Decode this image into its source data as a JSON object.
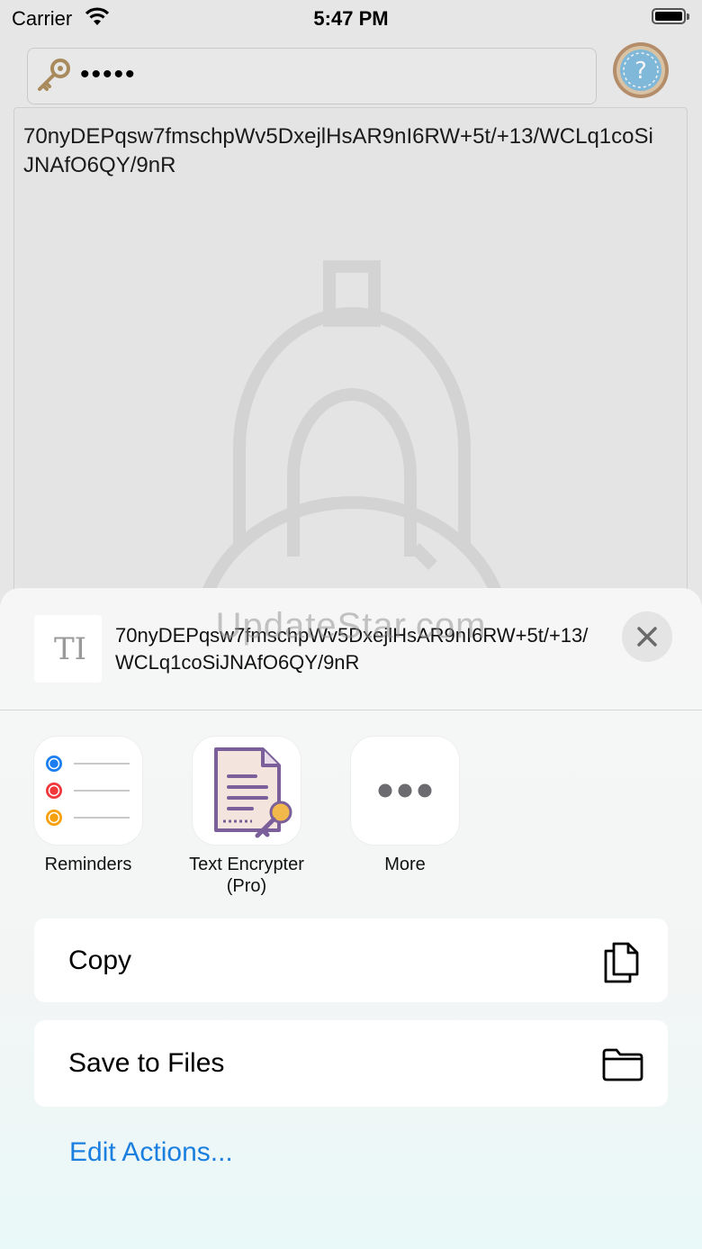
{
  "status_bar": {
    "carrier": "Carrier",
    "time": "5:47 PM"
  },
  "password_field": {
    "value": "•••••"
  },
  "editor": {
    "text": "70nyDEPqsw7fmschpWv5DxejlHsAR9nI6RW+5t/+13/WCLq1coSiJNAfO6QY/9nR"
  },
  "share_sheet": {
    "watermark": "UpdateStar.com",
    "preview_text": "70nyDEPqsw7fmschpWv5DxejlHsAR9nI6RW+5t/+13/WCLq1coSiJNAfO6QY/9nR",
    "apps": [
      {
        "label": "Reminders",
        "icon": "reminders-icon"
      },
      {
        "label": "Text Encrypter (Pro)",
        "icon": "text-encrypter-icon"
      },
      {
        "label": "More",
        "icon": "more-icon"
      }
    ],
    "actions": [
      {
        "label": "Copy",
        "icon": "copy-icon"
      },
      {
        "label": "Save to Files",
        "icon": "folder-icon"
      }
    ],
    "edit_actions": "Edit Actions...",
    "colors": {
      "link": "#1b7fe0",
      "reminder_blue": "#1a7ef0",
      "reminder_red": "#f0383b",
      "reminder_orange": "#f5a00f"
    }
  }
}
